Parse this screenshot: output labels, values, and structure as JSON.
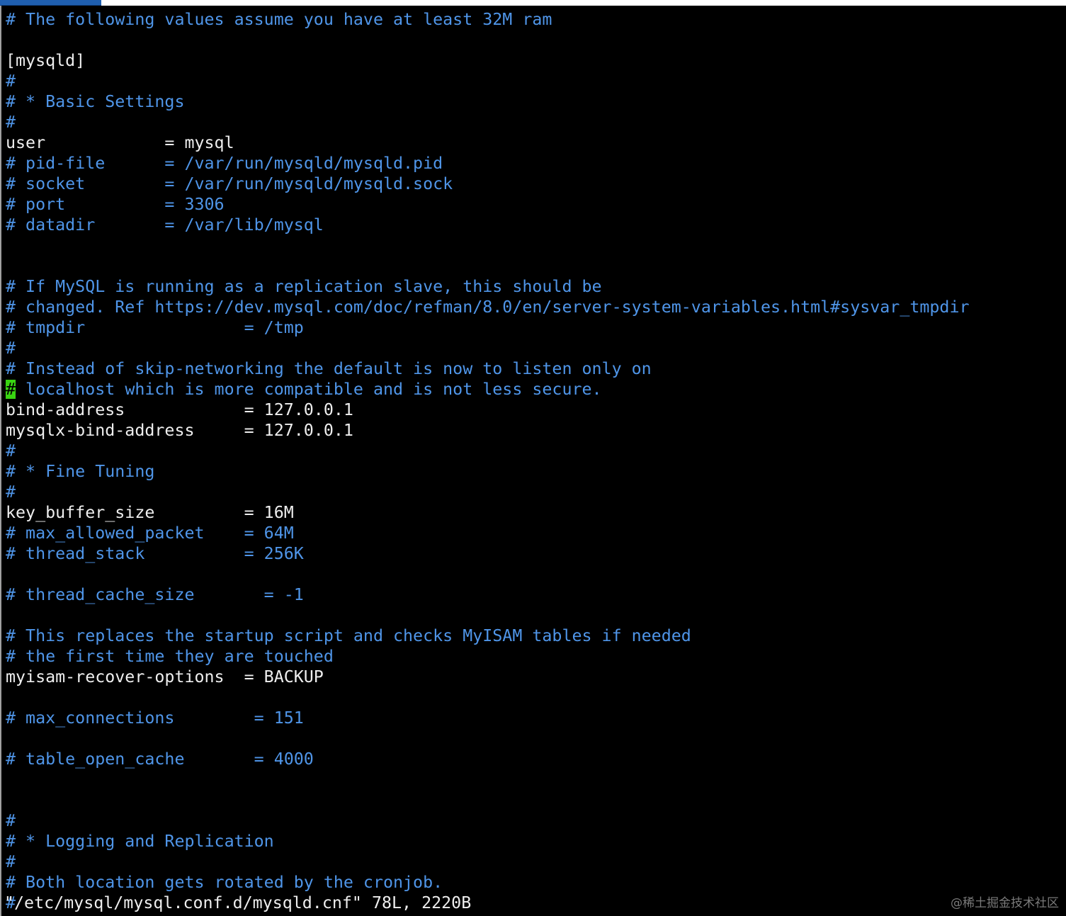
{
  "window": {
    "tab_title": ""
  },
  "colors": {
    "background": "#000000",
    "comment": "#4f95e8",
    "text": "#eeeeee",
    "cursor": "#39d411"
  },
  "editor": {
    "lines": [
      {
        "text": "# The following values assume you have at least 32M ram",
        "kind": "comment"
      },
      {
        "text": "",
        "kind": "blank"
      },
      {
        "text": "[mysqld]",
        "kind": "plain"
      },
      {
        "text": "#",
        "kind": "comment"
      },
      {
        "text": "# * Basic Settings",
        "kind": "comment"
      },
      {
        "text": "#",
        "kind": "comment"
      },
      {
        "text": "user            = mysql",
        "kind": "plain"
      },
      {
        "text": "# pid-file      = /var/run/mysqld/mysqld.pid",
        "kind": "comment"
      },
      {
        "text": "# socket        = /var/run/mysqld/mysqld.sock",
        "kind": "comment"
      },
      {
        "text": "# port          = 3306",
        "kind": "comment"
      },
      {
        "text": "# datadir       = /var/lib/mysql",
        "kind": "comment"
      },
      {
        "text": "",
        "kind": "blank"
      },
      {
        "text": "",
        "kind": "blank"
      },
      {
        "text": "# If MySQL is running as a replication slave, this should be",
        "kind": "comment"
      },
      {
        "text": "# changed. Ref https://dev.mysql.com/doc/refman/8.0/en/server-system-variables.html#sysvar_tmpdir",
        "kind": "comment"
      },
      {
        "text": "# tmpdir                = /tmp",
        "kind": "comment"
      },
      {
        "text": "#",
        "kind": "comment"
      },
      {
        "text": "# Instead of skip-networking the default is now to listen only on",
        "kind": "comment"
      },
      {
        "text": "# localhost which is more compatible and is not less secure.",
        "kind": "comment",
        "cursor": true
      },
      {
        "text": "bind-address            = 127.0.0.1",
        "kind": "plain"
      },
      {
        "text": "mysqlx-bind-address     = 127.0.0.1",
        "kind": "plain"
      },
      {
        "text": "#",
        "kind": "comment"
      },
      {
        "text": "# * Fine Tuning",
        "kind": "comment"
      },
      {
        "text": "#",
        "kind": "comment"
      },
      {
        "text": "key_buffer_size         = 16M",
        "kind": "plain"
      },
      {
        "text": "# max_allowed_packet    = 64M",
        "kind": "comment"
      },
      {
        "text": "# thread_stack          = 256K",
        "kind": "comment"
      },
      {
        "text": "",
        "kind": "blank"
      },
      {
        "text": "# thread_cache_size       = -1",
        "kind": "comment"
      },
      {
        "text": "",
        "kind": "blank"
      },
      {
        "text": "# This replaces the startup script and checks MyISAM tables if needed",
        "kind": "comment"
      },
      {
        "text": "# the first time they are touched",
        "kind": "comment"
      },
      {
        "text": "myisam-recover-options  = BACKUP",
        "kind": "plain"
      },
      {
        "text": "",
        "kind": "blank"
      },
      {
        "text": "# max_connections        = 151",
        "kind": "comment"
      },
      {
        "text": "",
        "kind": "blank"
      },
      {
        "text": "# table_open_cache       = 4000",
        "kind": "comment"
      },
      {
        "text": "",
        "kind": "blank"
      },
      {
        "text": "",
        "kind": "blank"
      },
      {
        "text": "#",
        "kind": "comment"
      },
      {
        "text": "# * Logging and Replication",
        "kind": "comment"
      },
      {
        "text": "#",
        "kind": "comment"
      },
      {
        "text": "# Both location gets rotated by the cronjob.",
        "kind": "comment"
      },
      {
        "text": "#",
        "kind": "comment"
      }
    ]
  },
  "status": {
    "text": "\"/etc/mysql/mysql.conf.d/mysqld.cnf\" 78L, 2220B"
  },
  "watermark": {
    "text": "@稀土掘金技术社区"
  }
}
